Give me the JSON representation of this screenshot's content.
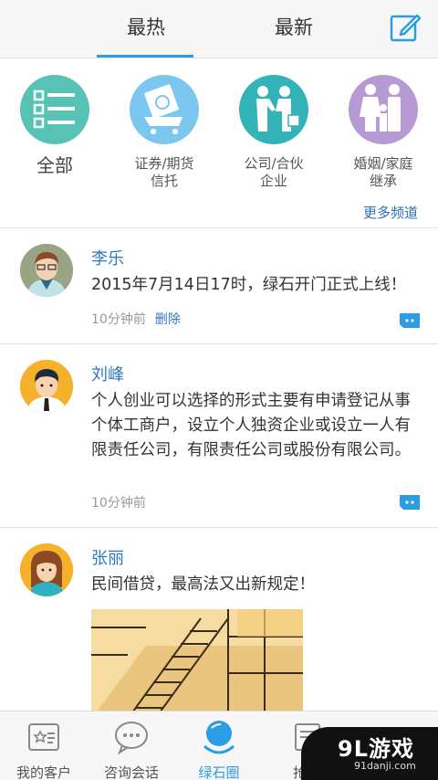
{
  "tabs": {
    "hot": "最热",
    "new": "最新"
  },
  "categories": [
    {
      "label": "全部",
      "icon": "list-icon",
      "color": "#57c3b5"
    },
    {
      "label": "证券/期货信托",
      "icon": "money-cart-icon",
      "color": "#7cc7ef"
    },
    {
      "label": "公司/合伙企业",
      "icon": "handshake-icon",
      "color": "#32b3b8"
    },
    {
      "label": "婚姻/家庭继承",
      "icon": "family-icon",
      "color": "#b59ad4"
    }
  ],
  "more_channels": "更多频道",
  "posts": [
    {
      "name": "李乐",
      "content": "2015年7月14日17时，绿石开门正式上线！",
      "time": "10分钟前",
      "delete": "删除"
    },
    {
      "name": "刘峰",
      "content": "个人创业可以选择的形式主要有申请登记从事个体工商户，设立个人独资企业或设立一人有限责任公司，有限责任公司或股份有限公司。",
      "time": "10分钟前"
    },
    {
      "name": "张丽",
      "content": "民间借贷，最高法又出新规定！"
    }
  ],
  "bottom_nav": [
    {
      "label": "我的客户",
      "icon": "customer-card-icon"
    },
    {
      "label": "咨询会话",
      "icon": "chat-bubble-icon"
    },
    {
      "label": "绿石圈",
      "icon": "green-stone-circle-icon"
    },
    {
      "label": "抢答",
      "icon": "qa-icon"
    }
  ],
  "watermark": {
    "logo": "9L游戏",
    "url": "91danji.com"
  },
  "colors": {
    "accent": "#2a9de4",
    "link": "#2f78c4"
  }
}
